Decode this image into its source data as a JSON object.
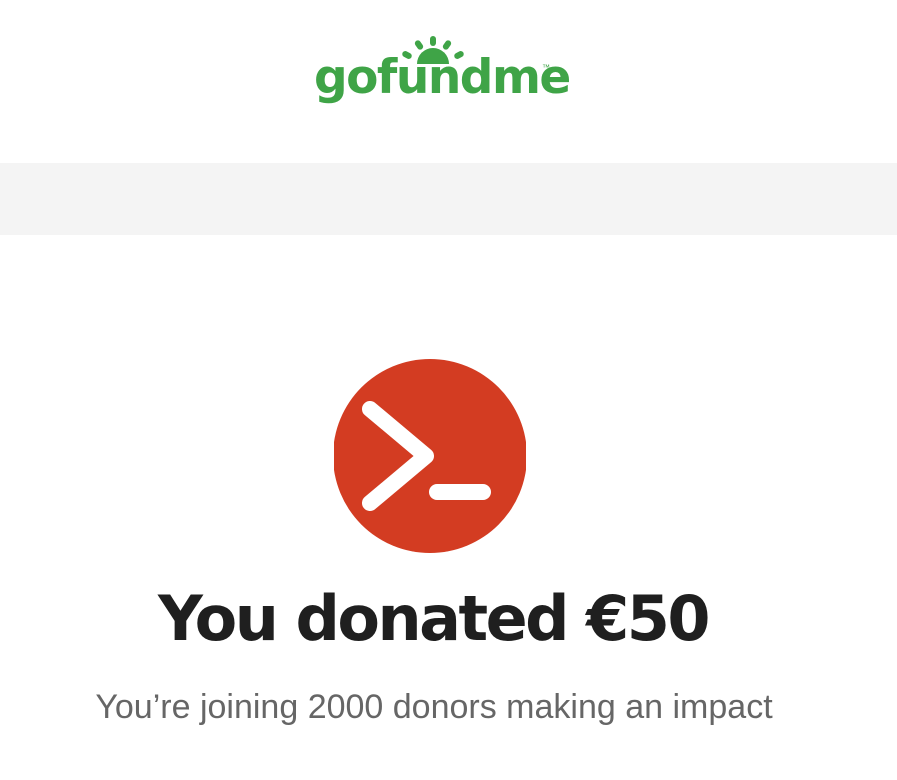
{
  "brand": {
    "name": "gofundme",
    "trademark": "™",
    "color": "#3fa447"
  },
  "campaign": {
    "avatar_icon": "terminal-prompt-icon",
    "avatar_color": "#d33c22"
  },
  "confirmation": {
    "title": "You donated €50",
    "subtitle": "You’re joining 2000 donors making an impact"
  }
}
